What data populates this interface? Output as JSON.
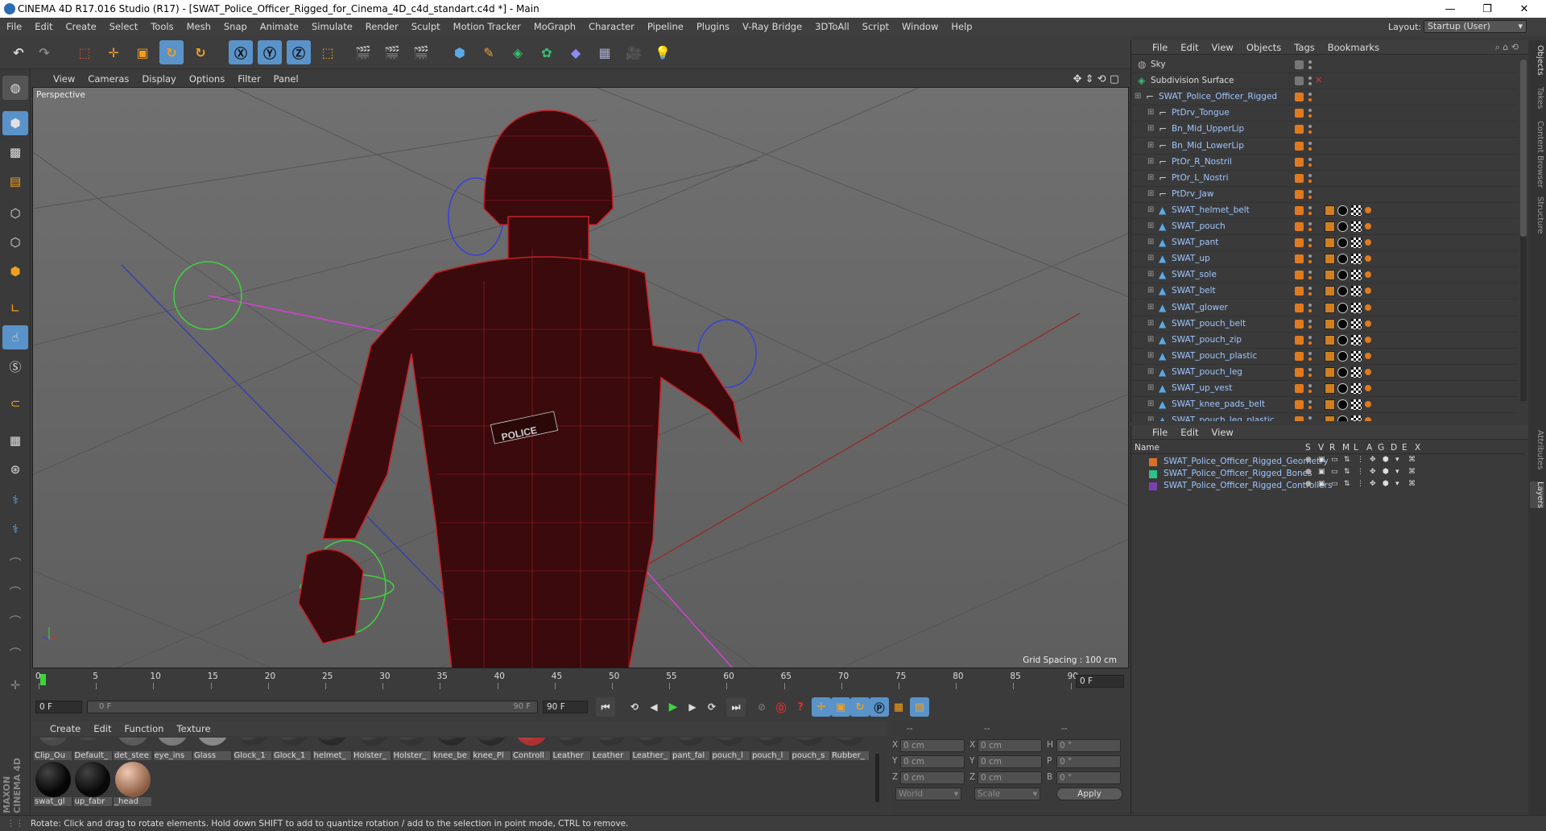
{
  "window": {
    "title": "CINEMA 4D R17.016 Studio (R17) - [SWAT_Police_Officer_Rigged_for_Cinema_4D_c4d_standart.c4d *] - Main",
    "controls": [
      "—",
      "❐",
      "✕"
    ]
  },
  "menu": [
    "File",
    "Edit",
    "Create",
    "Select",
    "Tools",
    "Mesh",
    "Snap",
    "Animate",
    "Simulate",
    "Render",
    "Sculpt",
    "Motion Tracker",
    "MoGraph",
    "Character",
    "Pipeline",
    "Plugins",
    "V-Ray Bridge",
    "3DToAll",
    "Script",
    "Window",
    "Help"
  ],
  "layout": {
    "label": "Layout:",
    "value": "Startup (User)"
  },
  "viewport": {
    "menu": [
      "View",
      "Cameras",
      "Display",
      "Options",
      "Filter",
      "Panel"
    ],
    "label": "Perspective",
    "grid_spacing": "Grid Spacing : 100 cm",
    "badge": "POLICE"
  },
  "timeline": {
    "ticks": [
      "0",
      "5",
      "10",
      "15",
      "20",
      "25",
      "30",
      "35",
      "40",
      "45",
      "50",
      "55",
      "60",
      "65",
      "70",
      "75",
      "80",
      "85",
      "90"
    ],
    "end_field": "0 F"
  },
  "playbar": {
    "current": "0 F",
    "range_start": "0 F",
    "range_end": "90 F",
    "max": "90 F"
  },
  "materials": {
    "menu": [
      "Create",
      "Edit",
      "Function",
      "Texture"
    ],
    "row1": [
      "Clip_Ou",
      "Default_",
      "det_stee",
      "eye_ins",
      "Glass",
      "Glock_1",
      "Glock_1",
      "helmet_",
      "Holster_",
      "Holster_",
      "knee_be",
      "knee_Pl",
      "Controll",
      "Leather",
      "Leather",
      "Leather_",
      "pant_fal",
      "pouch_l",
      "pouch_l",
      "pouch_s",
      "Rubber_"
    ],
    "row2": [
      "swat_gl",
      "up_fabr",
      "_head"
    ]
  },
  "coords": {
    "header": [
      "--",
      "--",
      "--"
    ],
    "rows": [
      {
        "a": "X",
        "av": "0 cm",
        "b": "X",
        "bv": "0 cm",
        "c": "H",
        "cv": "0 °"
      },
      {
        "a": "Y",
        "av": "0 cm",
        "b": "Y",
        "bv": "0 cm",
        "c": "P",
        "cv": "0 °"
      },
      {
        "a": "Z",
        "av": "0 cm",
        "b": "Z",
        "bv": "0 cm",
        "c": "B",
        "cv": "0 °"
      }
    ],
    "world": "World",
    "scale": "Scale",
    "apply": "Apply"
  },
  "objects": {
    "menu": [
      "File",
      "Edit",
      "View",
      "Objects",
      "Tags",
      "Bookmarks"
    ],
    "items": [
      "Sky",
      "Subdivision Surface",
      "SWAT_Police_Officer_Rigged",
      "PtDrv_Tongue",
      "Bn_Mid_UpperLip",
      "Bn_Mid_LowerLip",
      "PtOr_R_Nostril",
      "PtOr_L_Nostri",
      "PtDrv_Jaw",
      "SWAT_helmet_belt",
      "SWAT_pouch",
      "SWAT_pant",
      "SWAT_up",
      "SWAT_sole",
      "SWAT_belt",
      "SWAT_glower",
      "SWAT_pouch_belt",
      "SWAT_pouch_zip",
      "SWAT_pouch_plastic",
      "SWAT_pouch_leg",
      "SWAT_up_vest",
      "SWAT_knee_pads_belt",
      "SWAT_pouch_leg_plastic"
    ]
  },
  "layers": {
    "menu": [
      "File",
      "Edit",
      "View"
    ],
    "columns": [
      "Name",
      "S",
      "V",
      "R",
      "M",
      "L",
      "A",
      "G",
      "D",
      "E",
      "X"
    ],
    "items": [
      {
        "name": "SWAT_Police_Officer_Rigged_Geometry",
        "color": "#d9702a"
      },
      {
        "name": "SWAT_Police_Officer_Rigged_Bones",
        "color": "#2fbf8a"
      },
      {
        "name": "SWAT_Police_Officer_Rigged_Controllers",
        "color": "#7a3fb0"
      }
    ]
  },
  "side_tabs": [
    "Objects",
    "Takes",
    "Content Browser",
    "Structure",
    "Attributes",
    "Layers"
  ],
  "status": "Rotate: Click and drag to rotate elements. Hold down SHIFT to add to quantize rotation / add to the selection in point mode, CTRL to remove.",
  "brand": "MAXON CINEMA 4D",
  "colors": {
    "accent_blue": "#3c8fd6",
    "wire": "#c4222a",
    "orange": "#e07a1f"
  }
}
